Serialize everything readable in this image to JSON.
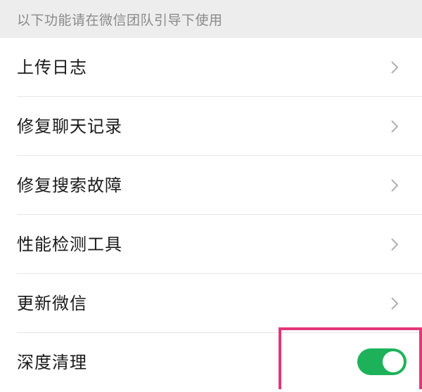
{
  "section": {
    "header": "以下功能请在微信团队引导下使用"
  },
  "items": [
    {
      "label": "上传日志",
      "control": "chevron-right-icon"
    },
    {
      "label": "修复聊天记录",
      "control": "chevron-right-icon"
    },
    {
      "label": "修复搜索故障",
      "control": "chevron-right-icon"
    },
    {
      "label": "性能检测工具",
      "control": "chevron-right-icon"
    },
    {
      "label": "更新微信",
      "control": "chevron-right-icon"
    },
    {
      "label": "深度清理",
      "control": "toggle",
      "toggle_on": true
    }
  ],
  "colors": {
    "header_bg": "#ededed",
    "header_text": "#8a8a8a",
    "toggle_on": "#1db25a",
    "highlight_box": "#e3367a",
    "chevron": "#b0b0b0"
  }
}
